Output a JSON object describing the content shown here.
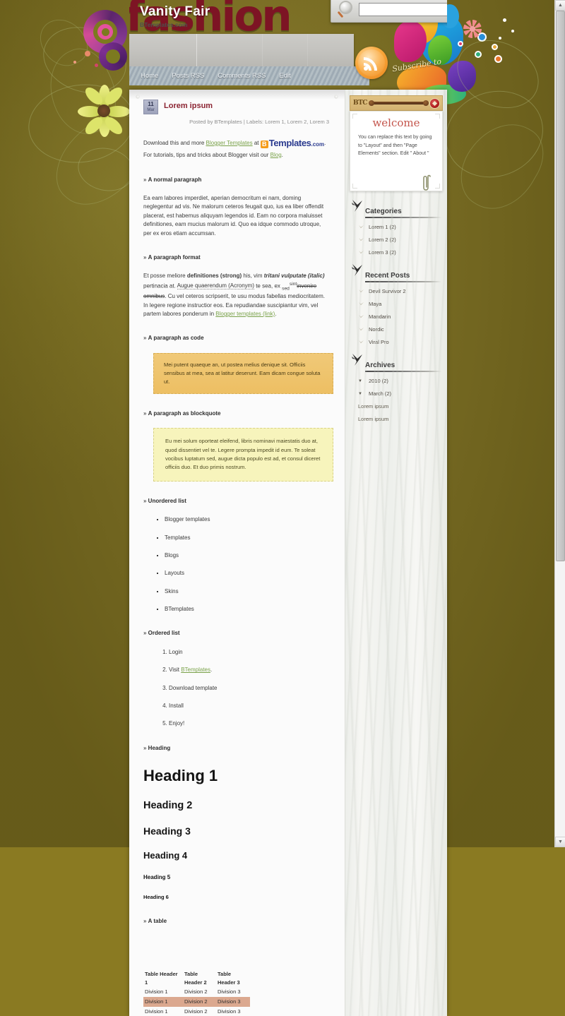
{
  "background": {
    "base_color": "#85771f",
    "accent_maroon": "#7d1424"
  },
  "header": {
    "wordmark": "fashion",
    "blog_title": "Vanity Fair",
    "blog_subtitle": "BTemplates.com",
    "subscribe_label": "Subscribe to",
    "rss_icon": "rss-icon",
    "search": {
      "value": "",
      "placeholder": "",
      "icon": "search-icon"
    },
    "nav": [
      {
        "label": "Home"
      },
      {
        "label": "Posts RSS"
      },
      {
        "label": "Comments RSS"
      },
      {
        "label": "Edit"
      }
    ]
  },
  "post": {
    "date_day": "11",
    "date_month": "Mar",
    "title": "Lorem ipsum",
    "meta": "Posted by BTemplates | Labels: Lorem 1, Lorem 2, Lorem 3",
    "intro_before": "Download this and more ",
    "intro_link": "Blogger Templates",
    "intro_at": " at ",
    "logo_mark": "B",
    "logo_name": "Templates",
    "logo_tld": ".com",
    "intro_after": ". For tutorials, tips and tricks about Blogger visit our ",
    "intro_link2": "Blog",
    "intro_end": ".",
    "sections": {
      "normal_paragraph": "A normal paragraph",
      "paragraph_format": "A paragraph format",
      "paragraph_code": "A paragraph as code",
      "paragraph_blockquote": "A paragraph as blockquote",
      "unordered_list": "Unordered list",
      "ordered_list": "Ordered list",
      "heading": "Heading",
      "a_table": "A table"
    },
    "normal_text": "Ea eam labores imperdiet, aperian democritum ei nam, doming neglegentur ad vis. Ne malorum ceteros feugait quo, ius ea liber offendit placerat, est habemus aliquyam legendos id. Eam no corpora maluisset definitiones, eam mucius malorum id. Quo ea idque commodo utroque, per ex eros etiam accumsan.",
    "format_parts": {
      "p1": "Et posse meliore ",
      "strong": "definitiones (strong)",
      "p2": " his, vim ",
      "italic": "tritani vulputate (italic)",
      "p3": " pertinacia at. ",
      "acronym": "Augue quaerendum (Acronym)",
      "p4": " te sea, ex ",
      "sub": "sed",
      "sup": "sint",
      "strike": "invenire omnibus",
      "p5": ". Cu vel ceteros scripserit, te usu modus fabellas mediocritatem. In legere regione instructior eos. Ea repudiandae suscipiantur vim, vel partem labores ponderum in ",
      "link": "Blogger templates (link)",
      "p6": "."
    },
    "code_text": "Mei putent quaeque an, ut postea melius denique sit. Officiis sensibus at mea, sea at latitur deserunt. Eam dicam congue soluta ut.",
    "quote_text": "Eu mei solum oporteat eleifend, libris nominavi maiestatis duo at, quod dissentiet vel te. Legere prompta impedit id eum. Te soleat vocibus luptatum sed, augue dicta populo est ad, et consul diceret officiis duo. Et duo primis nostrum.",
    "ul_items": [
      "Blogger templates",
      "Templates",
      "Blogs",
      "Layouts",
      "Skins",
      "BTemplates"
    ],
    "ol_items": [
      {
        "text": "Login"
      },
      {
        "text": "Visit ",
        "link": "BTemplates",
        "after": "."
      },
      {
        "text": "Download template"
      },
      {
        "text": "Install"
      },
      {
        "text": "Enjoy!"
      }
    ],
    "headings": {
      "h1": "Heading 1",
      "h2": "Heading 2",
      "h3": "Heading 3",
      "h4": "Heading 4",
      "h5": "Heading 5",
      "h6": "Heading 6"
    },
    "table": {
      "headers": [
        "Table Header 1",
        "Table Header 2",
        "Table Header 3"
      ],
      "rows": [
        [
          "Division 1",
          "Division 2",
          "Division 3"
        ],
        [
          "Division 1",
          "Division 2",
          "Division 3"
        ],
        [
          "Division 1",
          "Division 2",
          "Division 3"
        ]
      ],
      "highlighted_row_index": 1,
      "highlight_color": "#dba88f"
    }
  },
  "sidebar": {
    "welcome": {
      "logo": "BTC",
      "title": "welcome",
      "text": "You can replace this text by going to \"Layout\" and then \"Page Elements\" section. Edit \" About \""
    },
    "categories": {
      "title": "Categories",
      "items": [
        {
          "label": "Lorem 1 (2)"
        },
        {
          "label": "Lorem 2 (2)"
        },
        {
          "label": "Lorem 3 (2)"
        }
      ]
    },
    "recent_posts": {
      "title": "Recent Posts",
      "items": [
        {
          "label": "Devil Survivor 2"
        },
        {
          "label": "Maya"
        },
        {
          "label": "Mandarin"
        },
        {
          "label": "Nordic"
        },
        {
          "label": "Viral Pro"
        }
      ]
    },
    "archives": {
      "title": "Archives",
      "year": "2010 (2)",
      "month": "March (2)",
      "posts": [
        {
          "label": "Lorem ipsum"
        },
        {
          "label": "Lorem ipsum"
        }
      ]
    }
  },
  "scrollbar": {
    "up": "▲",
    "down": "▼"
  }
}
